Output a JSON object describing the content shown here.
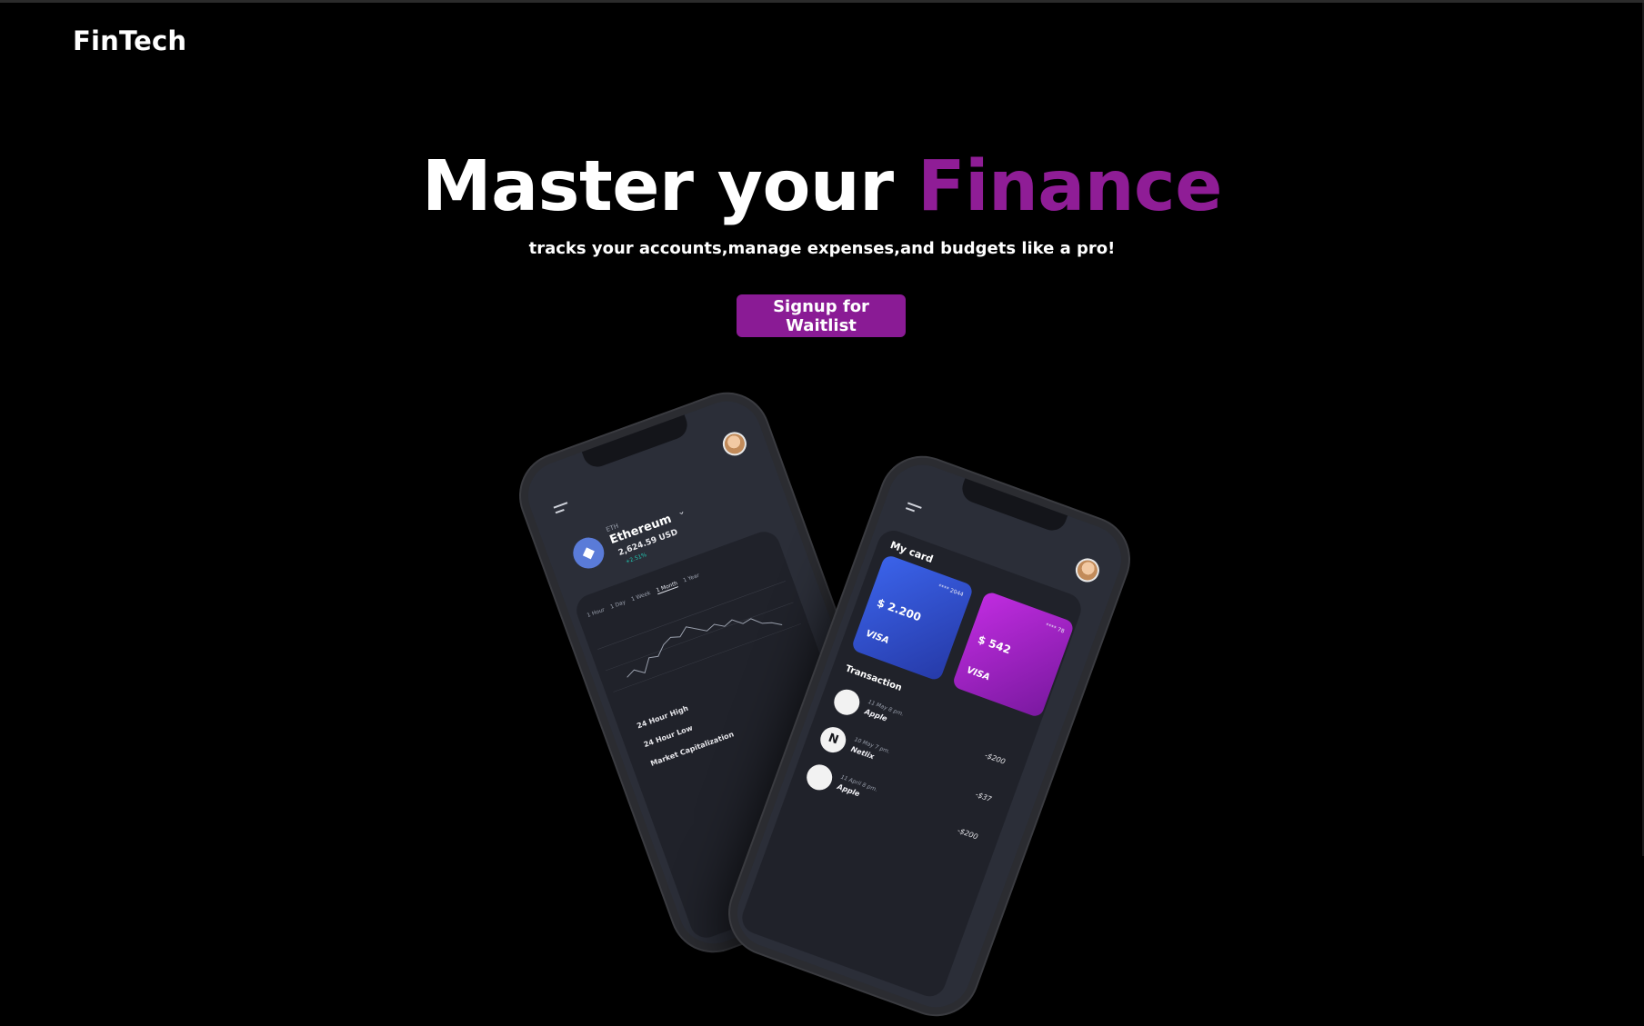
{
  "brand": {
    "logo": "FinTech"
  },
  "hero": {
    "title_main": "Master your ",
    "title_accent": "Finance",
    "subtitle": "tracks your accounts,manage expenses,and budgets like a pro!",
    "cta_label": "Signup for Waitlist"
  },
  "colors": {
    "accent": "#8a1b95",
    "background": "#000000",
    "text": "#ffffff"
  },
  "phone_back": {
    "coin_tag": "ETH",
    "coin_name": "Ethereum",
    "price": "2,624.59 USD",
    "change": "+2.51%",
    "ranges": [
      "1 Hour",
      "1 Day",
      "1 Week",
      "1 Month",
      "1 Year"
    ],
    "stats": [
      "24 Hour High",
      "24 Hour Low",
      "Market Capitalization"
    ]
  },
  "phone_front": {
    "cards_label": "My card",
    "cards": [
      {
        "number": "**** 2044",
        "amount": "$ 2.200",
        "brand": "VISA"
      },
      {
        "number": "**** 78",
        "amount": "$ 542",
        "brand": "VISA"
      }
    ],
    "transactions_label": "Transaction",
    "transactions": [
      {
        "icon": "apple-icon",
        "date": "11 May 8 pm.",
        "name": "Apple",
        "amount": "-$200"
      },
      {
        "icon": "netflix-icon",
        "date": "10 May 7 pm.",
        "name": "Netlix",
        "amount": "-$37"
      },
      {
        "icon": "apple-icon",
        "date": "11 April 8 pm.",
        "name": "Apple",
        "amount": "-$200"
      }
    ]
  }
}
